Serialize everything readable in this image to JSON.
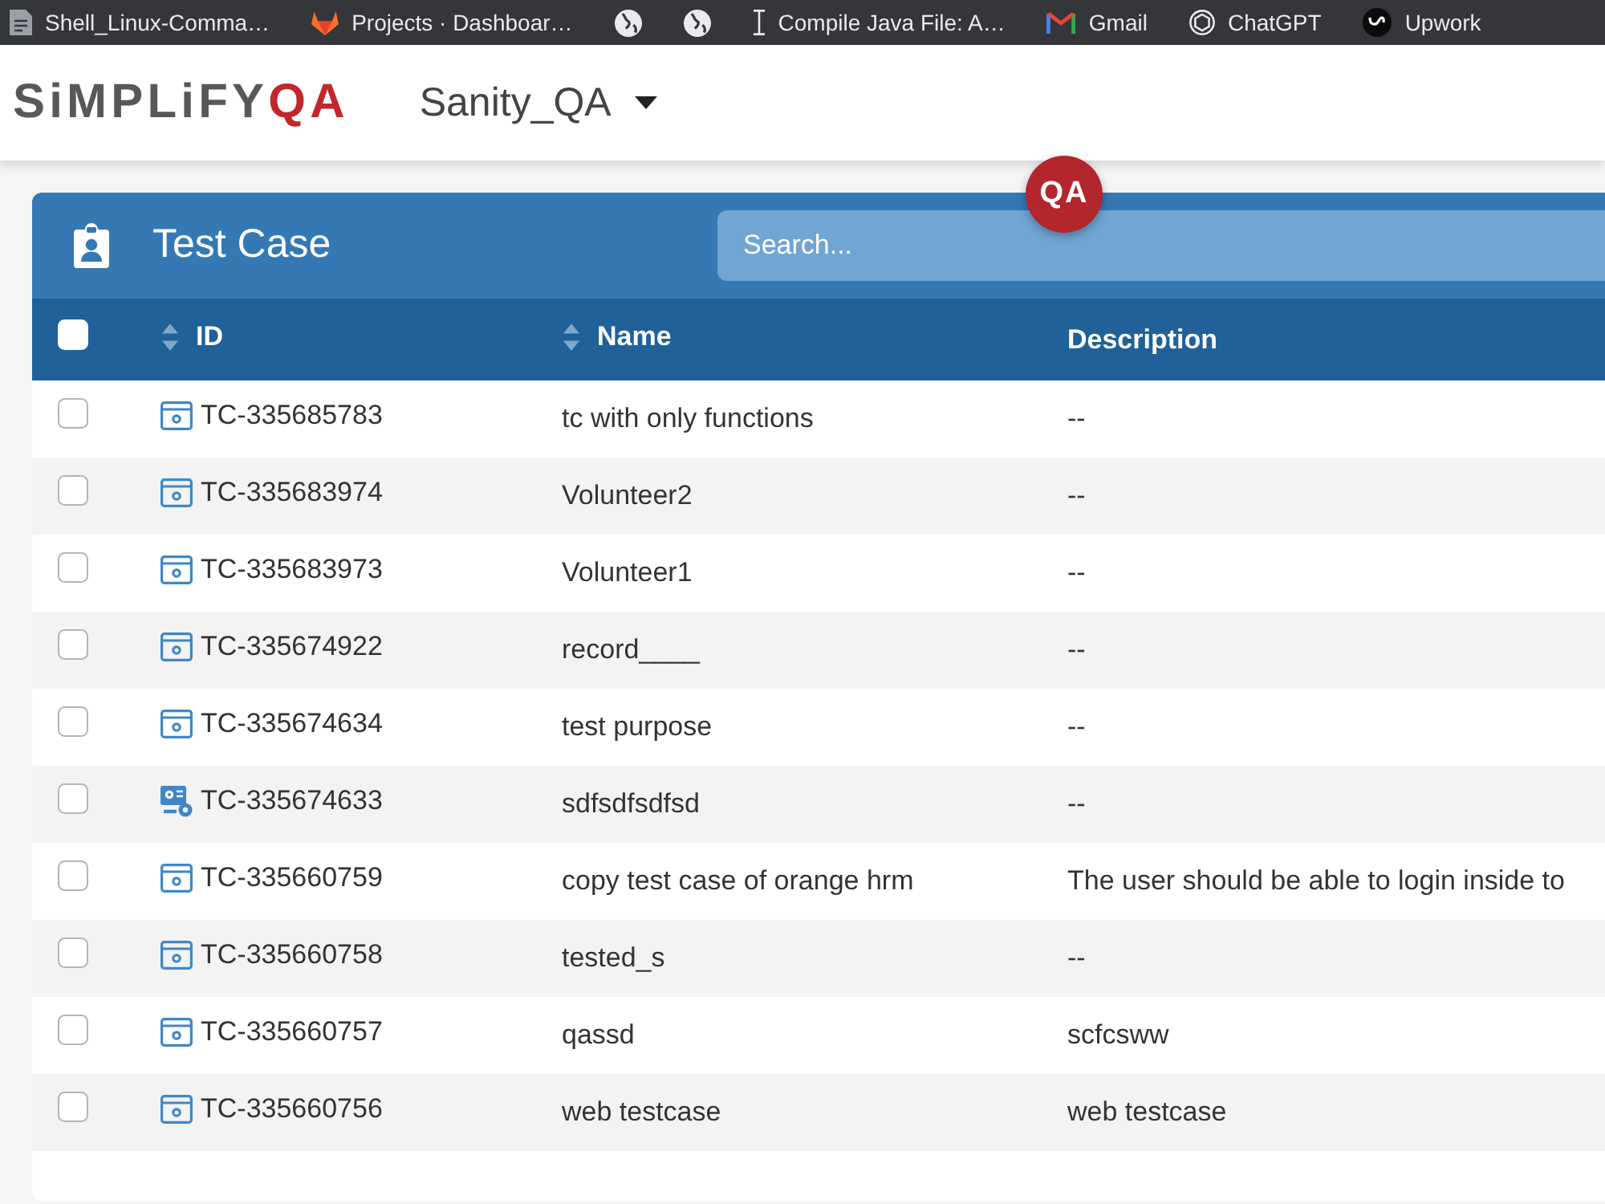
{
  "bookmarks": [
    {
      "kind": "labeled",
      "label": "Shell_Linux-Comma…"
    },
    {
      "kind": "labeled",
      "label": "Projects · Dashboar…"
    },
    {
      "kind": "icon"
    },
    {
      "kind": "icon"
    },
    {
      "kind": "labeled",
      "label": "Compile Java File: A…"
    },
    {
      "kind": "labeled",
      "label": "Gmail"
    },
    {
      "kind": "labeled",
      "label": "ChatGPT"
    },
    {
      "kind": "labeled",
      "label": "Upwork"
    }
  ],
  "header": {
    "logo": {
      "main": "SiMPLiFY",
      "accent": "QA"
    },
    "project": "Sanity_QA"
  },
  "floating_logo": {
    "text": "QA"
  },
  "panel": {
    "title": "Test Case",
    "search": {
      "placeholder": "Search..."
    }
  },
  "table": {
    "select_all": {
      "checked": false
    },
    "columns": [
      {
        "label": "ID",
        "sortable": true
      },
      {
        "label": "Name",
        "sortable": true
      },
      {
        "label": "Description",
        "sortable": false
      }
    ],
    "rows": [
      {
        "checked": false,
        "kind": "browser",
        "id": "TC-335685783",
        "name": "tc with only functions",
        "description": "--"
      },
      {
        "checked": false,
        "kind": "browser",
        "id": "TC-335683974",
        "name": "Volunteer2",
        "description": "--"
      },
      {
        "checked": false,
        "kind": "browser",
        "id": "TC-335683973",
        "name": "Volunteer1",
        "description": "--"
      },
      {
        "checked": false,
        "kind": "browser",
        "id": "TC-335674922",
        "name": "record____",
        "description": "--"
      },
      {
        "checked": false,
        "kind": "browser",
        "id": "TC-335674634",
        "name": "test purpose",
        "description": "--"
      },
      {
        "checked": false,
        "kind": "system",
        "id": "TC-335674633",
        "name": "sdfsdfsdfsd",
        "description": "--"
      },
      {
        "checked": false,
        "kind": "browser",
        "id": "TC-335660759",
        "name": "copy test case of orange hrm",
        "description": "The user should be able to login inside to"
      },
      {
        "checked": false,
        "kind": "browser",
        "id": "TC-335660758",
        "name": "tested_s",
        "description": "--"
      },
      {
        "checked": false,
        "kind": "browser",
        "id": "TC-335660757",
        "name": "qassd",
        "description": "scfcsww"
      },
      {
        "checked": false,
        "kind": "browser",
        "id": "TC-335660756",
        "name": "web testcase",
        "description": "web testcase"
      }
    ]
  }
}
